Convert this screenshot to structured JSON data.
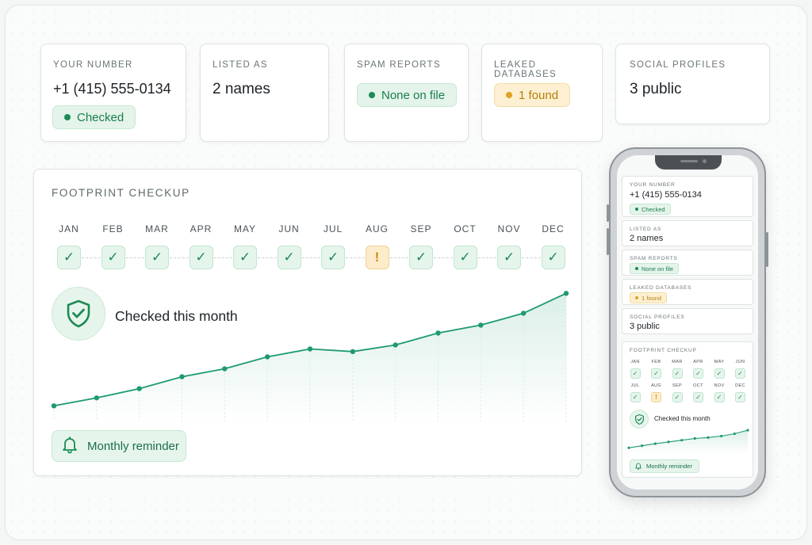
{
  "colors": {
    "accent": "#1e8a55",
    "accent_soft": "#e6f5ec",
    "warning": "#d08a10",
    "warning_soft": "#fdeccb",
    "line": "#1e9a70"
  },
  "summary": {
    "number": {
      "label": "YOUR NUMBER",
      "value": "+1 (415) 555-0134",
      "badge": "Checked"
    },
    "listed": {
      "label": "LISTED AS",
      "value": "2 names"
    },
    "spam": {
      "label": "SPAM REPORTS",
      "badge": "None on file"
    },
    "leaks": {
      "label": "LEAKED DATABASES",
      "badge": "1 found"
    },
    "social": {
      "label": "SOCIAL PROFILES",
      "value": "3 public"
    }
  },
  "footprint": {
    "title": "FOOTPRINT CHECKUP",
    "months": [
      {
        "label": "JAN",
        "status": "ok",
        "icon": "check-icon"
      },
      {
        "label": "FEB",
        "status": "ok",
        "icon": "check-icon"
      },
      {
        "label": "MAR",
        "status": "ok",
        "icon": "check-icon"
      },
      {
        "label": "APR",
        "status": "ok",
        "icon": "check-icon"
      },
      {
        "label": "MAY",
        "status": "ok",
        "icon": "check-icon"
      },
      {
        "label": "JUN",
        "status": "ok",
        "icon": "check-icon"
      },
      {
        "label": "JUL",
        "status": "ok",
        "icon": "check-icon"
      },
      {
        "label": "AUG",
        "status": "warn",
        "icon": "exclamation-icon"
      },
      {
        "label": "SEP",
        "status": "ok",
        "icon": "check-icon"
      },
      {
        "label": "OCT",
        "status": "ok",
        "icon": "check-icon"
      },
      {
        "label": "NOV",
        "status": "ok",
        "icon": "check-icon"
      },
      {
        "label": "DEC",
        "status": "ok",
        "icon": "check-icon"
      }
    ],
    "shield_icon": "shield-check-icon",
    "status_text": "Checked this month",
    "reminder_label": "Monthly reminder",
    "reminder_icon": "bell-icon"
  },
  "chart_data": {
    "type": "area",
    "x": [
      1,
      2,
      3,
      4,
      5,
      6,
      7,
      8,
      9,
      10,
      11,
      12,
      13
    ],
    "values": [
      10,
      16,
      23,
      32,
      38,
      47,
      53,
      51,
      56,
      65,
      71,
      80,
      95
    ],
    "ylim": [
      0,
      100
    ],
    "grid": false,
    "legend": "none"
  },
  "mobile": {
    "months_row1": [
      "JAN",
      "FEB",
      "MAR",
      "APR",
      "MAY",
      "JUN"
    ],
    "months_row2": [
      "JUL",
      "AUG",
      "SEP",
      "OCT",
      "NOV",
      "DEC"
    ],
    "chart_values": [
      10,
      17,
      24,
      30,
      36,
      42,
      45,
      50,
      58,
      70
    ]
  }
}
